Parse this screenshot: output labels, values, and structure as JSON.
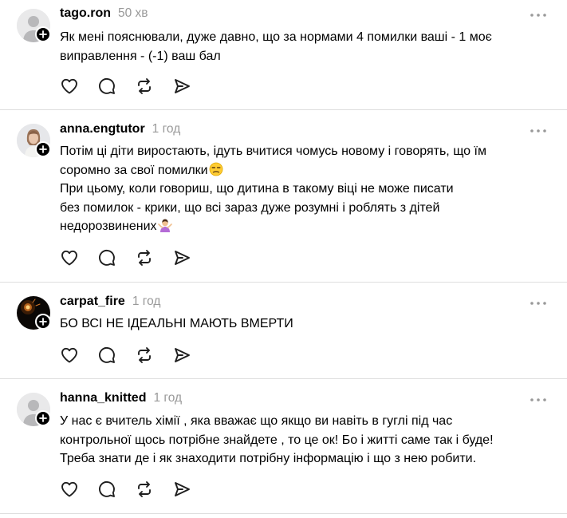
{
  "comments": [
    {
      "username": "tago.ron",
      "time": "50 хв",
      "avatar": "default-avatar",
      "lines": [
        "Як мені пояснювали, дуже давно, що за нормами 4 помилки ваші - 1 моє",
        "виправлення - (-1) ваш бал"
      ]
    },
    {
      "username": "anna.engtutor",
      "time": "1 год",
      "avatar": "photo-avatar",
      "lines": [
        "Потім ці діти виростають, ідуть вчитися чомусь новому і говорять, що їм",
        "соромно за свої помилки",
        "При цьому, коли говориш, що дитина в такому віці не може писати",
        "без помилок - крики, що всі зараз дуже розумні і роблять з дітей",
        "недорозвинених"
      ],
      "emojis": [
        "unamused-face-emoji",
        "person-shrugging-emoji"
      ]
    },
    {
      "username": "carpat_fire",
      "time": "1 год",
      "avatar": "fire-photo-avatar",
      "lines": [
        "БО ВСІ НЕ ІДЕАЛЬНІ МАЮТЬ ВМЕРТИ"
      ]
    },
    {
      "username": "hanna_knitted",
      "time": "1 год",
      "avatar": "default-avatar",
      "lines": [
        "У нас є вчитель хімії , яка вважає що якщо ви навіть в гуглі під час",
        "контрольної щось потрібне знайдете , то це ок! Бо і житті саме так і буде!",
        "Треба знати де і як знаходити потрібну інформацію і що з нею робити."
      ]
    }
  ],
  "icons": {
    "like": "heart-icon",
    "reply": "comment-bubble-icon",
    "repost": "repost-icon",
    "share": "send-icon",
    "more": "more-options-icon",
    "follow": "plus-icon"
  },
  "colors": {
    "text": "#000000",
    "muted": "#999999",
    "divider": "#dedede",
    "icon": "#1f1f1f"
  }
}
